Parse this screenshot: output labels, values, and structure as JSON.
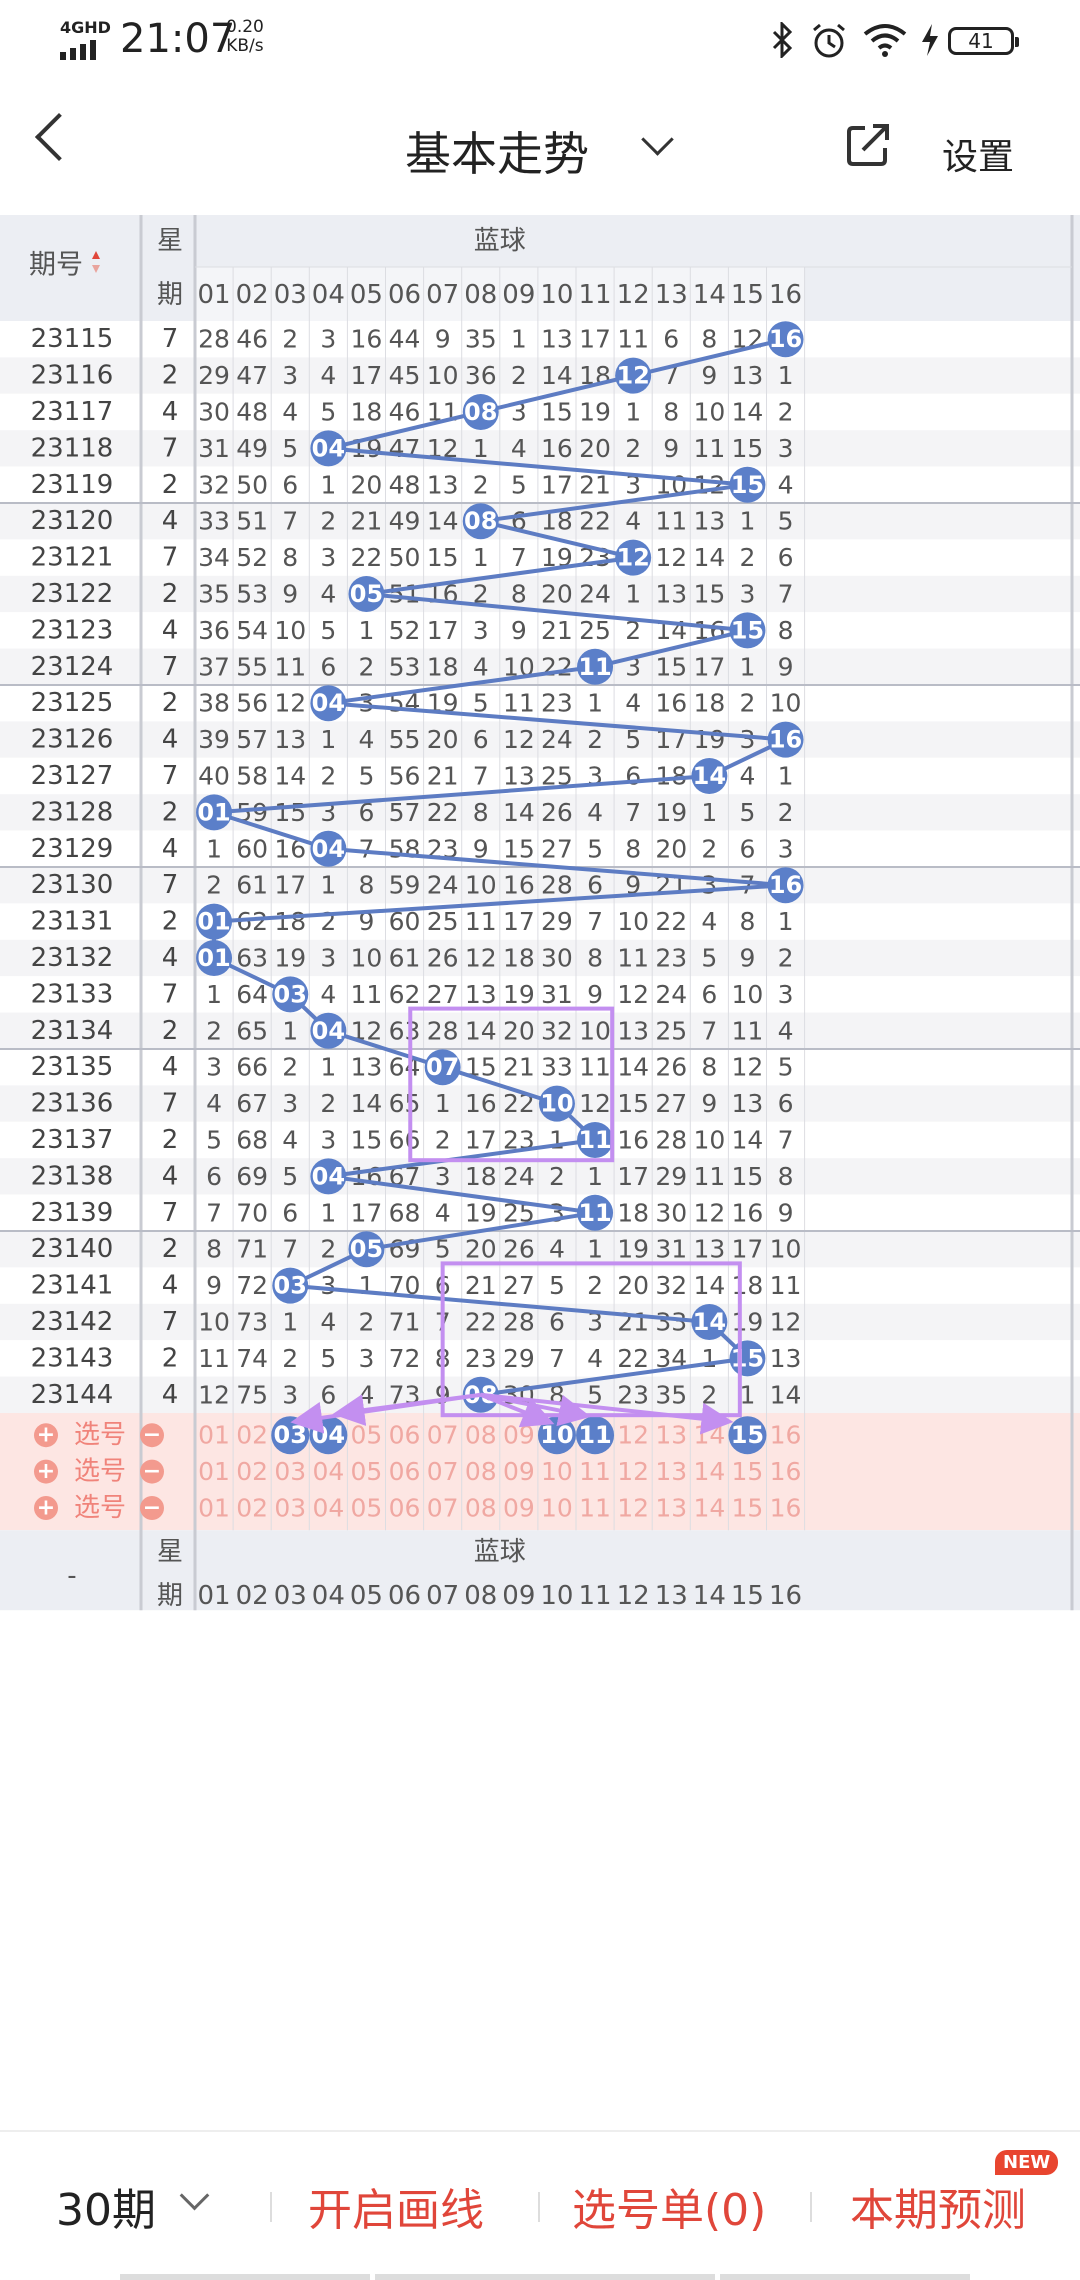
{
  "status_bar": {
    "network": "4GHD",
    "time": "21:07",
    "speed_value": "0.20",
    "speed_unit": "KB/s",
    "battery": "41",
    "icons": [
      "bluetooth-icon",
      "alarm-icon",
      "wifi-icon",
      "charging-icon",
      "battery-icon"
    ]
  },
  "header": {
    "back_icon": "chevron-left-icon",
    "title": "基本走势",
    "title_dropdown_icon": "chevron-down-icon",
    "share_icon": "share-icon",
    "settings_label": "设置"
  },
  "table": {
    "period_header": "期号",
    "week_header_top": "星",
    "week_header_bottom": "期",
    "group_label": "蓝球",
    "columns": [
      "01",
      "02",
      "03",
      "04",
      "05",
      "06",
      "07",
      "08",
      "09",
      "10",
      "11",
      "12",
      "13",
      "14",
      "15",
      "16"
    ],
    "rows": [
      {
        "period": "23115",
        "week": "7",
        "values": [
          "28",
          "46",
          "2",
          "3",
          "16",
          "44",
          "9",
          "35",
          "1",
          "13",
          "17",
          "11",
          "6",
          "8",
          "12",
          "16"
        ],
        "hit": 16
      },
      {
        "period": "23116",
        "week": "2",
        "values": [
          "29",
          "47",
          "3",
          "4",
          "17",
          "45",
          "10",
          "36",
          "2",
          "14",
          "18",
          "12",
          "7",
          "9",
          "13",
          "1"
        ],
        "hit": 12
      },
      {
        "period": "23117",
        "week": "4",
        "values": [
          "30",
          "48",
          "4",
          "5",
          "18",
          "46",
          "11",
          "08",
          "3",
          "15",
          "19",
          "1",
          "8",
          "10",
          "14",
          "2"
        ],
        "hit": 8
      },
      {
        "period": "23118",
        "week": "7",
        "values": [
          "31",
          "49",
          "5",
          "04",
          "19",
          "47",
          "12",
          "1",
          "4",
          "16",
          "20",
          "2",
          "9",
          "11",
          "15",
          "3"
        ],
        "hit": 4
      },
      {
        "period": "23119",
        "week": "2",
        "values": [
          "32",
          "50",
          "6",
          "1",
          "20",
          "48",
          "13",
          "2",
          "5",
          "17",
          "21",
          "3",
          "10",
          "12",
          "15",
          "4"
        ],
        "hit": 15
      },
      {
        "period": "23120",
        "week": "4",
        "values": [
          "33",
          "51",
          "7",
          "2",
          "21",
          "49",
          "14",
          "08",
          "6",
          "18",
          "22",
          "4",
          "11",
          "13",
          "1",
          "5"
        ],
        "hit": 8
      },
      {
        "period": "23121",
        "week": "7",
        "values": [
          "34",
          "52",
          "8",
          "3",
          "22",
          "50",
          "15",
          "1",
          "7",
          "19",
          "23",
          "12",
          "12",
          "14",
          "2",
          "6"
        ],
        "hit": 12
      },
      {
        "period": "23122",
        "week": "2",
        "values": [
          "35",
          "53",
          "9",
          "4",
          "05",
          "51",
          "16",
          "2",
          "8",
          "20",
          "24",
          "1",
          "13",
          "15",
          "3",
          "7"
        ],
        "hit": 5
      },
      {
        "period": "23123",
        "week": "4",
        "values": [
          "36",
          "54",
          "10",
          "5",
          "1",
          "52",
          "17",
          "3",
          "9",
          "21",
          "25",
          "2",
          "14",
          "16",
          "15",
          "8"
        ],
        "hit": 15
      },
      {
        "period": "23124",
        "week": "7",
        "values": [
          "37",
          "55",
          "11",
          "6",
          "2",
          "53",
          "18",
          "4",
          "10",
          "22",
          "11",
          "3",
          "15",
          "17",
          "1",
          "9"
        ],
        "hit": 11
      },
      {
        "period": "23125",
        "week": "2",
        "values": [
          "38",
          "56",
          "12",
          "04",
          "3",
          "54",
          "19",
          "5",
          "11",
          "23",
          "1",
          "4",
          "16",
          "18",
          "2",
          "10"
        ],
        "hit": 4
      },
      {
        "period": "23126",
        "week": "4",
        "values": [
          "39",
          "57",
          "13",
          "1",
          "4",
          "55",
          "20",
          "6",
          "12",
          "24",
          "2",
          "5",
          "17",
          "19",
          "3",
          "16"
        ],
        "hit": 16
      },
      {
        "period": "23127",
        "week": "7",
        "values": [
          "40",
          "58",
          "14",
          "2",
          "5",
          "56",
          "21",
          "7",
          "13",
          "25",
          "3",
          "6",
          "18",
          "14",
          "4",
          "1"
        ],
        "hit": 14
      },
      {
        "period": "23128",
        "week": "2",
        "values": [
          "01",
          "59",
          "15",
          "3",
          "6",
          "57",
          "22",
          "8",
          "14",
          "26",
          "4",
          "7",
          "19",
          "1",
          "5",
          "2"
        ],
        "hit": 1
      },
      {
        "period": "23129",
        "week": "4",
        "values": [
          "1",
          "60",
          "16",
          "04",
          "7",
          "58",
          "23",
          "9",
          "15",
          "27",
          "5",
          "8",
          "20",
          "2",
          "6",
          "3"
        ],
        "hit": 4
      },
      {
        "period": "23130",
        "week": "7",
        "values": [
          "2",
          "61",
          "17",
          "1",
          "8",
          "59",
          "24",
          "10",
          "16",
          "28",
          "6",
          "9",
          "21",
          "3",
          "7",
          "16"
        ],
        "hit": 16
      },
      {
        "period": "23131",
        "week": "2",
        "values": [
          "01",
          "62",
          "18",
          "2",
          "9",
          "60",
          "25",
          "11",
          "17",
          "29",
          "7",
          "10",
          "22",
          "4",
          "8",
          "1"
        ],
        "hit": 1
      },
      {
        "period": "23132",
        "week": "4",
        "values": [
          "01",
          "63",
          "19",
          "3",
          "10",
          "61",
          "26",
          "12",
          "18",
          "30",
          "8",
          "11",
          "23",
          "5",
          "9",
          "2"
        ],
        "hit": 1
      },
      {
        "period": "23133",
        "week": "7",
        "values": [
          "1",
          "64",
          "03",
          "4",
          "11",
          "62",
          "27",
          "13",
          "19",
          "31",
          "9",
          "12",
          "24",
          "6",
          "10",
          "3"
        ],
        "hit": 3
      },
      {
        "period": "23134",
        "week": "2",
        "values": [
          "2",
          "65",
          "1",
          "04",
          "12",
          "63",
          "28",
          "14",
          "20",
          "32",
          "10",
          "13",
          "25",
          "7",
          "11",
          "4"
        ],
        "hit": 4
      },
      {
        "period": "23135",
        "week": "4",
        "values": [
          "3",
          "66",
          "2",
          "1",
          "13",
          "64",
          "07",
          "15",
          "21",
          "33",
          "11",
          "14",
          "26",
          "8",
          "12",
          "5"
        ],
        "hit": 7
      },
      {
        "period": "23136",
        "week": "7",
        "values": [
          "4",
          "67",
          "3",
          "2",
          "14",
          "65",
          "1",
          "16",
          "22",
          "10",
          "12",
          "15",
          "27",
          "9",
          "13",
          "6"
        ],
        "hit": 10
      },
      {
        "period": "23137",
        "week": "2",
        "values": [
          "5",
          "68",
          "4",
          "3",
          "15",
          "66",
          "2",
          "17",
          "23",
          "1",
          "11",
          "16",
          "28",
          "10",
          "14",
          "7"
        ],
        "hit": 11
      },
      {
        "period": "23138",
        "week": "4",
        "values": [
          "6",
          "69",
          "5",
          "04",
          "16",
          "67",
          "3",
          "18",
          "24",
          "2",
          "1",
          "17",
          "29",
          "11",
          "15",
          "8"
        ],
        "hit": 4
      },
      {
        "period": "23139",
        "week": "7",
        "values": [
          "7",
          "70",
          "6",
          "1",
          "17",
          "68",
          "4",
          "19",
          "25",
          "3",
          "11",
          "18",
          "30",
          "12",
          "16",
          "9"
        ],
        "hit": 11
      },
      {
        "period": "23140",
        "week": "2",
        "values": [
          "8",
          "71",
          "7",
          "2",
          "05",
          "69",
          "5",
          "20",
          "26",
          "4",
          "1",
          "19",
          "31",
          "13",
          "17",
          "10"
        ],
        "hit": 5
      },
      {
        "period": "23141",
        "week": "4",
        "values": [
          "9",
          "72",
          "03",
          "3",
          "1",
          "70",
          "6",
          "21",
          "27",
          "5",
          "2",
          "20",
          "32",
          "14",
          "18",
          "11"
        ],
        "hit": 3
      },
      {
        "period": "23142",
        "week": "7",
        "values": [
          "10",
          "73",
          "1",
          "4",
          "2",
          "71",
          "7",
          "22",
          "28",
          "6",
          "3",
          "21",
          "33",
          "14",
          "19",
          "12"
        ],
        "hit": 14
      },
      {
        "period": "23143",
        "week": "2",
        "values": [
          "11",
          "74",
          "2",
          "5",
          "3",
          "72",
          "8",
          "23",
          "29",
          "7",
          "4",
          "22",
          "34",
          "1",
          "15",
          "13"
        ],
        "hit": 15
      },
      {
        "period": "23144",
        "week": "4",
        "values": [
          "12",
          "75",
          "3",
          "6",
          "4",
          "73",
          "9",
          "08",
          "30",
          "8",
          "5",
          "23",
          "35",
          "2",
          "1",
          "14"
        ],
        "hit": 8
      }
    ],
    "selector_label": "选号",
    "selector_rows": [
      {
        "selected": [
          3,
          4,
          10,
          11,
          15
        ]
      },
      {
        "selected": []
      },
      {
        "selected": []
      }
    ],
    "footer_dash": "-"
  },
  "bottom_bar": {
    "periods": "30期",
    "draw_lines": "开启画线",
    "pick_list": "选号单(0)",
    "predict": "本期预测",
    "new_badge": "NEW"
  },
  "colors": {
    "ball": "#5b7fc9",
    "line": "#5d7cc3",
    "accent_red": "#e0463a",
    "annotation_purple": "#c38ff0",
    "selector_bg": "#fde6e3",
    "selector_num": "#f0a8a2"
  }
}
